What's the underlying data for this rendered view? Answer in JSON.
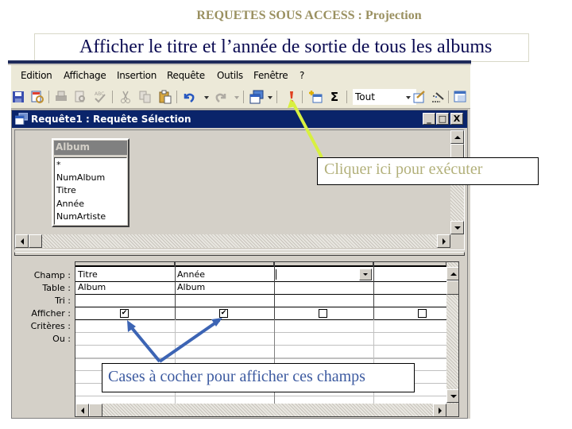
{
  "slide": {
    "title": "REQUETES SOUS ACCESS : Projection",
    "subtitle": "Afficher le titre et l’année de sortie de tous les albums"
  },
  "menubar": {
    "items": [
      {
        "label": "Edition",
        "icon": null
      },
      {
        "label": "Affichage"
      },
      {
        "label": "Insertion"
      },
      {
        "label": "Requête"
      },
      {
        "label": "Outils"
      },
      {
        "label": "Fenêtre"
      },
      {
        "label": "?"
      }
    ]
  },
  "toolbar": {
    "icons": [
      "save-icon",
      "design-view-icon",
      "print-icon",
      "print-preview-icon",
      "spelling-icon",
      "cut-icon",
      "copy-icon",
      "paste-icon",
      "undo-icon",
      "redo-icon",
      "query-type-icon",
      "run-icon",
      "show-table-icon",
      "totals-icon",
      "properties-icon",
      "builder-icon",
      "database-window-icon"
    ],
    "top_values": "Tout"
  },
  "query_window": {
    "title": "Requête1 : Requête Sélection",
    "minimize": "_",
    "maximize": "□",
    "close": "X",
    "table": {
      "name": "Album",
      "fields": [
        "*",
        "NumAlbum",
        "Titre",
        "Année",
        "NumArtiste"
      ]
    },
    "grid": {
      "row_labels": [
        "Champ :",
        "Table :",
        "Tri :",
        "Afficher :",
        "Critères :",
        "Ou :"
      ],
      "columns": [
        {
          "champ": "Titre",
          "table": "Album",
          "tri": "",
          "afficher": true,
          "criteres": "",
          "ou": ""
        },
        {
          "champ": "Année",
          "table": "Album",
          "tri": "",
          "afficher": true,
          "criteres": "",
          "ou": ""
        },
        {
          "champ": "",
          "table": "",
          "tri": "",
          "afficher": false,
          "criteres": "",
          "ou": ""
        },
        {
          "champ": "",
          "table": "",
          "tri": "",
          "afficher": false,
          "criteres": "",
          "ou": ""
        }
      ],
      "check_mark": "✔"
    }
  },
  "callouts": {
    "run": "Cliquer ici pour exécuter",
    "checkboxes": "Cases à cocher pour afficher ces champs"
  },
  "colors": {
    "title": "#9a9060",
    "subtitle": "#0b0b52",
    "titlebar": "#0a246a",
    "callout_run_text": "#b2b07a",
    "callout_check_text": "#3c5aa0",
    "arrow_run": "#d8f040",
    "arrow_check": "#3c64b4"
  }
}
